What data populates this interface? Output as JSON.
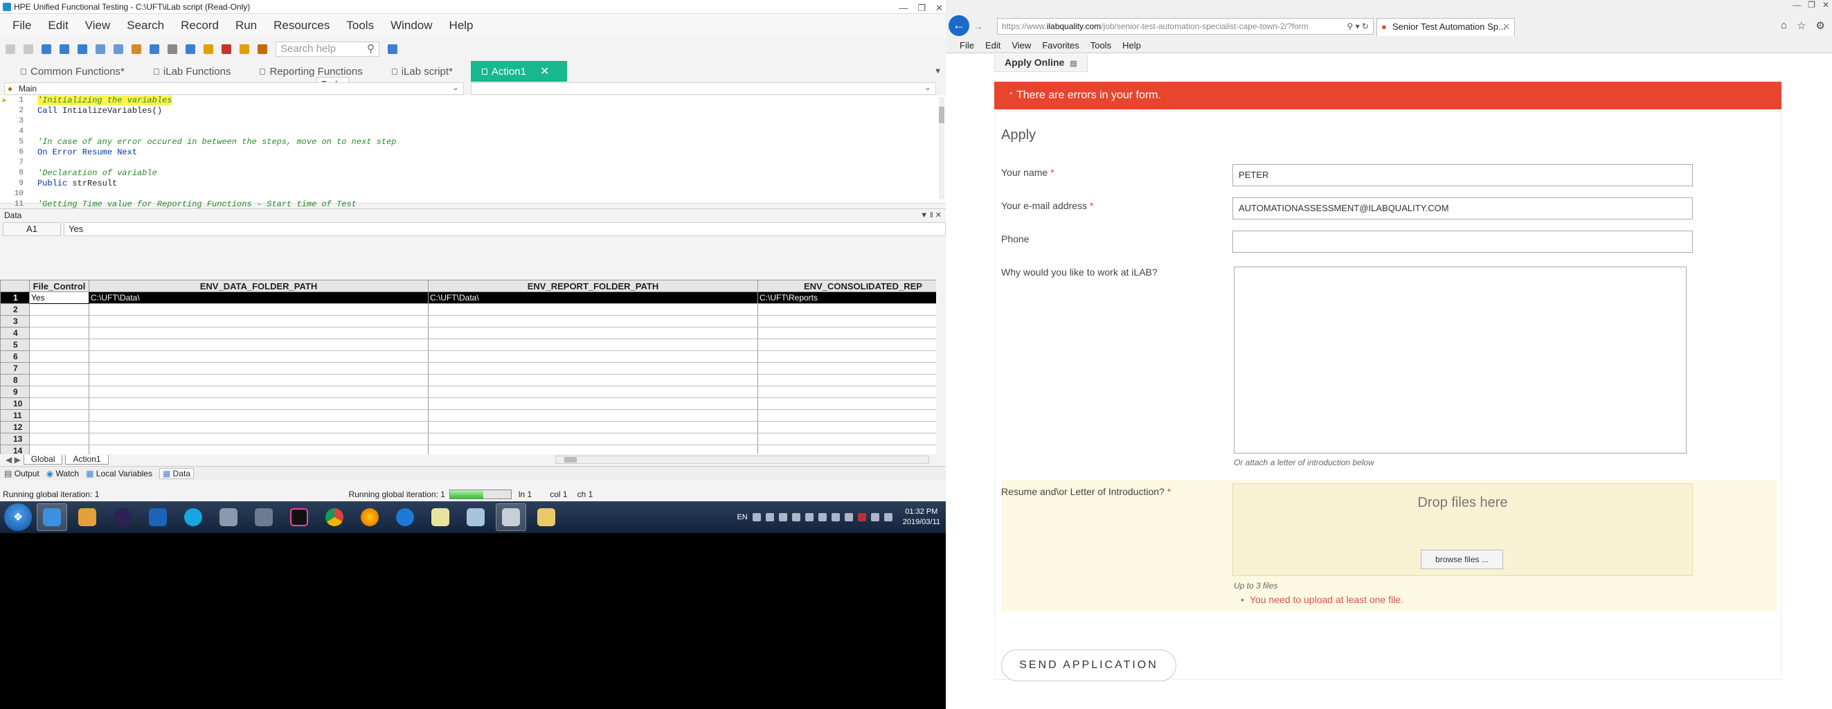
{
  "uft": {
    "title": "HPE Unified Functional Testing - C:\\UFT\\iLab script (Read-Only)",
    "menu": [
      "File",
      "Edit",
      "View",
      "Search",
      "Record",
      "Run",
      "Resources",
      "Tools",
      "Window",
      "Help"
    ],
    "search_placeholder": "Search help",
    "tabs": [
      {
        "label": "Common Functions*"
      },
      {
        "label": "iLab Functions"
      },
      {
        "label": "Reporting Functions"
      },
      {
        "label": "iLab script*"
      },
      {
        "label": "Action1"
      }
    ],
    "tooltip": "Tasks",
    "scope": "Main",
    "code": [
      {
        "n": "1",
        "text": "'Initializing the variables"
      },
      {
        "n": "2",
        "kw": "Call",
        "text": " IntializeVariables()"
      },
      {
        "n": "3",
        "text": ""
      },
      {
        "n": "4",
        "text": ""
      },
      {
        "n": "5",
        "text": "'In case of any error occured in between the steps, move on to next step"
      },
      {
        "n": "6",
        "kw": "On Error Resume Next",
        "text": ""
      },
      {
        "n": "7",
        "text": ""
      },
      {
        "n": "8",
        "text": "'Declaration of variable"
      },
      {
        "n": "9",
        "kw": "Public",
        "text": " strResult"
      },
      {
        "n": "10",
        "text": ""
      },
      {
        "n": "11",
        "text": "'Getting Time value for Reporting Functions - Start time of Test"
      }
    ],
    "data_title": "Data",
    "cell_ref": "A1",
    "cell_value": "Yes",
    "columns": [
      "File_Control",
      "ENV_DATA_FOLDER_PATH",
      "ENV_REPORT_FOLDER_PATH",
      "ENV_CONSOLIDATED_REP"
    ],
    "row1": [
      "Yes",
      "C:\\UFT\\Data\\",
      "C:\\UFT\\Data\\",
      "C:\\UFT\\Reports"
    ],
    "row_numbers": [
      "1",
      "2",
      "3",
      "4",
      "5",
      "6",
      "7",
      "8",
      "9",
      "10",
      "11",
      "12",
      "13",
      "14"
    ],
    "sheet_tabs": [
      "Global",
      "Action1"
    ],
    "panes": [
      "Output",
      "Watch",
      "Local Variables",
      "Data"
    ],
    "status_left": "Running global iteration: 1",
    "status_mid": "Running global iteration: 1",
    "progress": 0.55,
    "ln": "ln 1",
    "col": "col 1",
    "ch": "ch 1",
    "clock_time": "01:32 PM",
    "clock_date": "2019/03/11",
    "lang": "EN"
  },
  "ie": {
    "url_prefix": "https://www.",
    "url_host": "ilabquality.com",
    "url_rest": "/job/senior-test-automation-specialist-cape-town-2/?form",
    "tab_title": "Senior Test Automation Sp...",
    "menu": [
      "File",
      "Edit",
      "View",
      "Favorites",
      "Tools",
      "Help"
    ],
    "apply_online": "Apply Online",
    "error_banner": "There are errors in your form.",
    "apply_heading": "Apply",
    "fields": {
      "name_label": "Your name",
      "name_value": "PETER",
      "email_label": "Your e-mail address",
      "email_value": "AUTOMATIONASSESSMENT@ILABQUALITY.COM",
      "phone_label": "Phone",
      "phone_value": "",
      "why_label": "Why would you like to work at iLAB?",
      "attach_hint": "Or attach a letter of introduction below",
      "resume_label": "Resume and\\or Letter of Introduction?",
      "drop_text": "Drop files here",
      "browse_label": "browse files ...",
      "upto_hint": "Up to 3 files",
      "upload_error": "You need to upload at least one file."
    },
    "required_mark": "*",
    "send_label": "SEND APPLICATION"
  },
  "colors": {
    "active_tab": "#16b88d",
    "error_red": "#e8452f",
    "ie_nav_blue": "#1b6ac9"
  }
}
